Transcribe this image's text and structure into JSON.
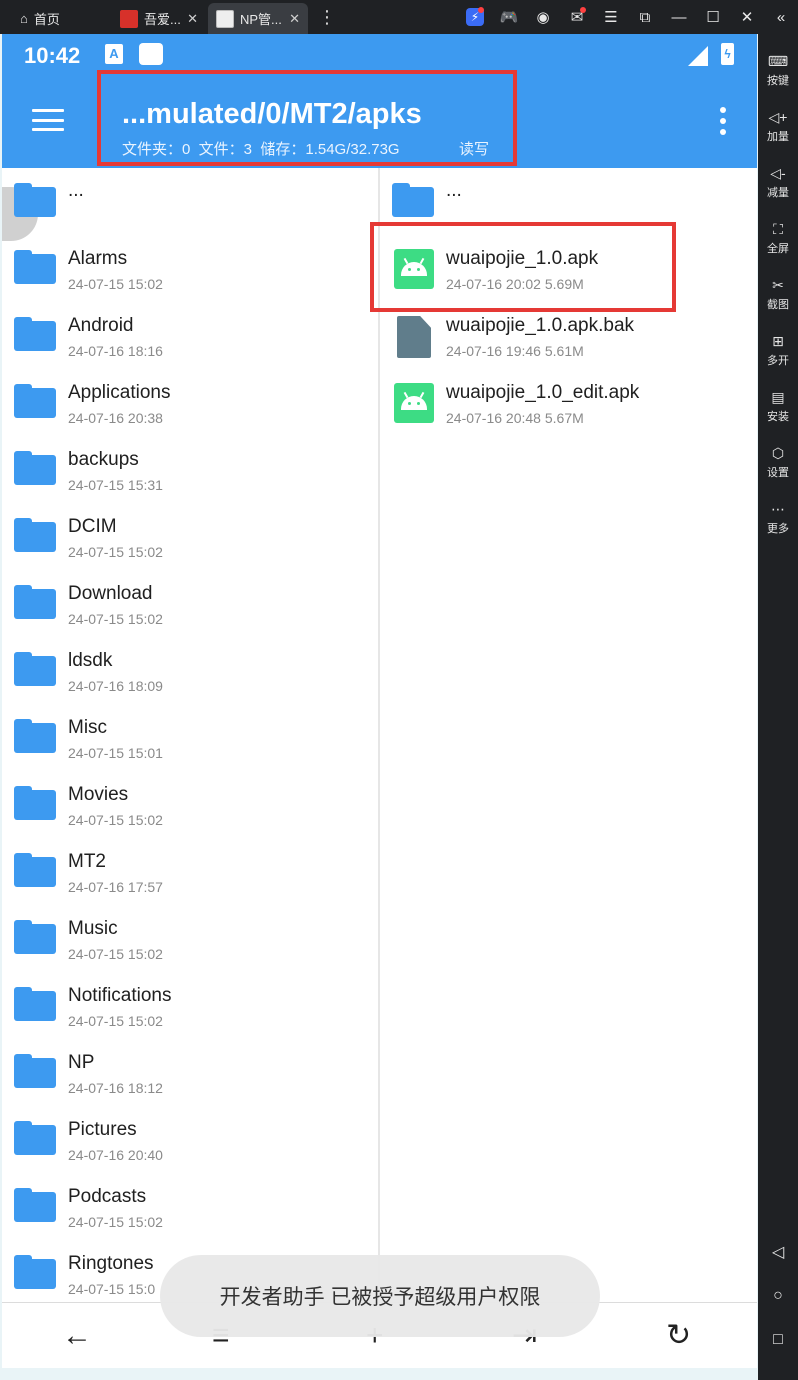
{
  "window": {
    "tabs": [
      {
        "label": "首页"
      },
      {
        "label": "吾爱..."
      },
      {
        "label": "NP管..."
      }
    ]
  },
  "emulator_sidebar": {
    "items": [
      {
        "label": "按键",
        "icon": "keyboard-icon"
      },
      {
        "label": "加量",
        "icon": "volume-up-icon"
      },
      {
        "label": "减量",
        "icon": "volume-down-icon"
      },
      {
        "label": "全屏",
        "icon": "fullscreen-icon"
      },
      {
        "label": "截图",
        "icon": "scissors-icon"
      },
      {
        "label": "多开",
        "icon": "multi-open-icon"
      },
      {
        "label": "安装",
        "icon": "apk-install-icon"
      },
      {
        "label": "设置",
        "icon": "settings-icon"
      },
      {
        "label": "更多",
        "icon": "more-icon"
      }
    ]
  },
  "status_bar": {
    "time": "10:42",
    "a_badge": "A"
  },
  "appbar": {
    "path": "...mulated/0/MT2/apks",
    "info": "文件夹：0  文件：3  储存：1.54G/32.73G",
    "permission": "读写",
    "accent": "#3d9af0"
  },
  "left_pane": {
    "up_label": "...",
    "items": [
      {
        "name": "Alarms",
        "meta": "24-07-15 15:02"
      },
      {
        "name": "Android",
        "meta": "24-07-16 18:16"
      },
      {
        "name": "Applications",
        "meta": "24-07-16 20:38"
      },
      {
        "name": "backups",
        "meta": "24-07-15 15:31"
      },
      {
        "name": "DCIM",
        "meta": "24-07-15 15:02"
      },
      {
        "name": "Download",
        "meta": "24-07-15 15:02"
      },
      {
        "name": "ldsdk",
        "meta": "24-07-16 18:09"
      },
      {
        "name": "Misc",
        "meta": "24-07-15 15:01"
      },
      {
        "name": "Movies",
        "meta": "24-07-15 15:02"
      },
      {
        "name": "MT2",
        "meta": "24-07-16 17:57"
      },
      {
        "name": "Music",
        "meta": "24-07-15 15:02"
      },
      {
        "name": "Notifications",
        "meta": "24-07-15 15:02"
      },
      {
        "name": "NP",
        "meta": "24-07-16 18:12"
      },
      {
        "name": "Pictures",
        "meta": "24-07-16 20:40"
      },
      {
        "name": "Podcasts",
        "meta": "24-07-15 15:02"
      },
      {
        "name": "Ringtones",
        "meta": "24-07-15 15:0"
      }
    ]
  },
  "right_pane": {
    "up_label": "...",
    "files": [
      {
        "name": "wuaipojie_1.0.apk",
        "meta": "24-07-16 20:02  5.69M",
        "type": "apk"
      },
      {
        "name": "wuaipojie_1.0.apk.bak",
        "meta": "24-07-16 19:46  5.61M",
        "type": "file"
      },
      {
        "name": "wuaipojie_1.0_edit.apk",
        "meta": "24-07-16 20:48  5.67M",
        "type": "apk"
      }
    ]
  },
  "toast": {
    "message": "开发者助手 已被授予超级用户权限"
  },
  "bottom_bar": {
    "back": "←",
    "list": "≡",
    "add": "+",
    "move": "⇥",
    "refresh": "↻"
  },
  "emulator_nav": {
    "back": "◁",
    "home": "○",
    "recent": "□"
  }
}
